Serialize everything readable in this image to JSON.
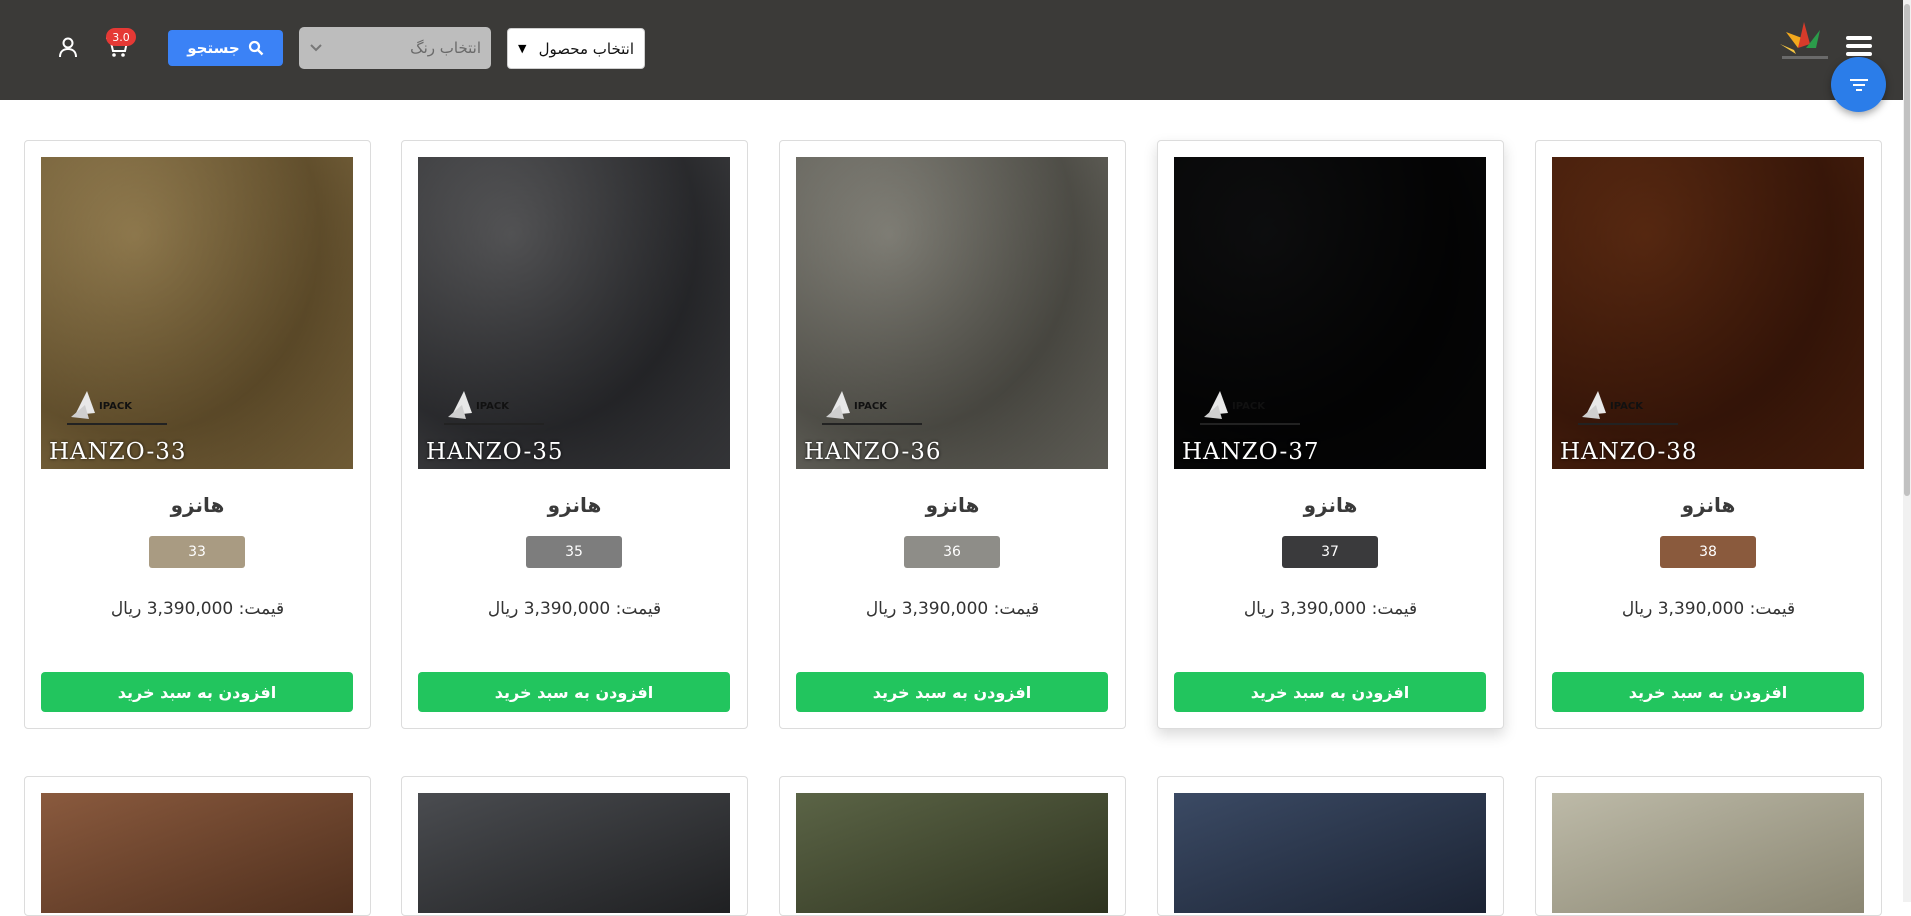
{
  "header": {
    "product_select_label": "انتخاب محصول",
    "color_select_placeholder": "انتخاب رنگ",
    "search_label": "جستجو",
    "cart_count": "3.0"
  },
  "products": [
    {
      "title": "هانزو",
      "code": "HANZO-38",
      "tag": "38",
      "price": "قیمت: 3,390,000 ریال",
      "button": "افزودن به سبد خرید",
      "tag_color": "#8a5a3d",
      "fabric": [
        "#9a6a45",
        "#6b4128"
      ]
    },
    {
      "title": "هانزو",
      "code": "HANZO-37",
      "tag": "37",
      "price": "قیمت: 3,390,000 ریال",
      "button": "افزودن به سبد خرید",
      "tag_color": "#3a3a3c",
      "fabric": [
        "#3f4042",
        "#151516"
      ]
    },
    {
      "title": "هانزو",
      "code": "HANZO-36",
      "tag": "36",
      "price": "قیمت: 3,390,000 ریال",
      "button": "افزودن به سبد خرید",
      "tag_color": "#8e8d88",
      "fabric": [
        "#bcbbb5",
        "#7d7c76"
      ]
    },
    {
      "title": "هانزو",
      "code": "HANZO-35",
      "tag": "35",
      "price": "قیمت: 3,390,000 ریال",
      "button": "افزودن به سبد خرید",
      "tag_color": "#7d7d7d",
      "fabric": [
        "#9a9a9b",
        "#55565a"
      ]
    },
    {
      "title": "هانزو",
      "code": "HANZO-33",
      "tag": "33",
      "price": "قیمت: 3,390,000 ریال",
      "button": "افزودن به سبد خرید",
      "tag_color": "#a99b82",
      "fabric": [
        "#c5b693",
        "#8f7f5c"
      ]
    }
  ],
  "next_row_fabrics": [
    [
      "#bdbaa8",
      "#8a8672"
    ],
    [
      "#3b4a64",
      "#1b2333"
    ],
    [
      "#5b6446",
      "#2e331f"
    ],
    [
      "#4a4c50",
      "#1f2022"
    ],
    [
      "#8a5a3e",
      "#4f2f1d"
    ]
  ],
  "colors": {
    "topbar": "#3b3a38",
    "accent": "#2b7de9",
    "buy_button": "#22c55e",
    "badge": "#e53935"
  }
}
